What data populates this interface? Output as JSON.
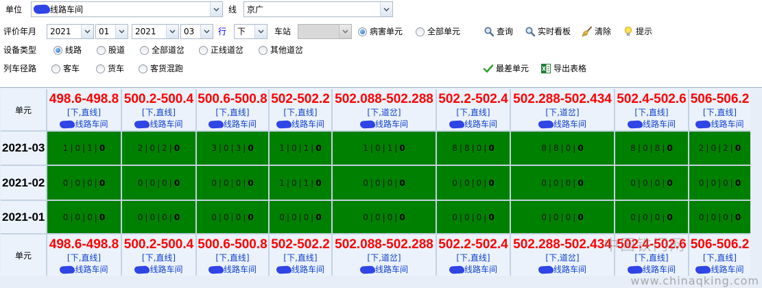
{
  "colors": {
    "defect_cell": "#008000",
    "range_text": "#ff0000",
    "unit_info_text": "#1040d0",
    "direction_label": "#0000ff",
    "redaction": "#2f45e6"
  },
  "form": {
    "unit": {
      "label": "单位",
      "value": "线路车间"
    },
    "line": {
      "label": "线",
      "value": "京广"
    },
    "period": {
      "label": "评价年月",
      "start_year": "2021",
      "start_month": "01",
      "end_year": "2021",
      "end_month": "03"
    },
    "direction": {
      "label": "行",
      "value": "下"
    },
    "station": {
      "label": "车站",
      "value": ""
    },
    "unit_scope": [
      {
        "label": "病害单元",
        "checked": true
      },
      {
        "label": "全部单元",
        "checked": false
      }
    ],
    "actions": [
      {
        "label": "查询",
        "icon": "search-icon"
      },
      {
        "label": "实时看板",
        "icon": "search-icon"
      },
      {
        "label": "清除",
        "icon": "broom-icon"
      },
      {
        "label": "提示",
        "icon": "bulb-icon"
      }
    ],
    "device_type": {
      "label": "设备类型",
      "options": [
        {
          "label": "线路",
          "checked": true
        },
        {
          "label": "股道",
          "checked": false
        },
        {
          "label": "全部道岔",
          "checked": false
        },
        {
          "label": "正线道岔",
          "checked": false
        },
        {
          "label": "其他道岔",
          "checked": false
        }
      ]
    },
    "train_route": {
      "label": "列车径路",
      "options": [
        {
          "label": "客车",
          "checked": false
        },
        {
          "label": "货车",
          "checked": false
        },
        {
          "label": "客货混跑",
          "checked": false
        }
      ]
    },
    "table_actions": [
      {
        "label": "最差单元",
        "icon": "check-icon"
      },
      {
        "label": "导出表格",
        "icon": "excel-icon"
      }
    ]
  },
  "table": {
    "corner_label": "单元",
    "cell_separator": "|",
    "columns": [
      {
        "range": "498.6-498.8",
        "type": "[下,直线]",
        "workshop": "线路车间"
      },
      {
        "range": "500.2-500.4",
        "type": "[下,直线]",
        "workshop": "线路车间"
      },
      {
        "range": "500.6-500.8",
        "type": "[下,直线]",
        "workshop": "线路车间"
      },
      {
        "range": "502-502.2",
        "type": "[下,直线]",
        "workshop": "线路车间"
      },
      {
        "range": "502.088-502.288",
        "type": "[下,道岔]",
        "workshop": "线路车间"
      },
      {
        "range": "502.2-502.4",
        "type": "[下,直线]",
        "workshop": "线路车间"
      },
      {
        "range": "502.288-502.434",
        "type": "[下,道岔]",
        "workshop": "线路车间"
      },
      {
        "range": "502.4-502.6",
        "type": "[下,直线]",
        "workshop": "线路车间"
      },
      {
        "range": "506-506.2",
        "type": "[下,直线]",
        "workshop": "线路车间"
      }
    ],
    "rows": [
      {
        "month": "2021-03",
        "cells": [
          [
            "1",
            "0",
            "1",
            "0"
          ],
          [
            "2",
            "0",
            "2",
            "0"
          ],
          [
            "3",
            "0",
            "3",
            "0"
          ],
          [
            "1",
            "0",
            "1",
            "0"
          ],
          [
            "1",
            "0",
            "1",
            "0"
          ],
          [
            "8",
            "8",
            "0",
            "0"
          ],
          [
            "8",
            "8",
            "0",
            "0"
          ],
          [
            "8",
            "0",
            "8",
            "0"
          ],
          [
            "2",
            "0",
            "2",
            "0"
          ]
        ]
      },
      {
        "month": "2021-02",
        "cells": [
          [
            "0",
            "0",
            "0",
            "0"
          ],
          [
            "0",
            "0",
            "0",
            "0"
          ],
          [
            "0",
            "0",
            "0",
            "0"
          ],
          [
            "1",
            "0",
            "1",
            "0"
          ],
          [
            "0",
            "0",
            "0",
            "0"
          ],
          [
            "0",
            "0",
            "0",
            "0"
          ],
          [
            "0",
            "0",
            "0",
            "0"
          ],
          [
            "0",
            "0",
            "0",
            "0"
          ],
          [
            "0",
            "0",
            "0",
            "0"
          ]
        ]
      },
      {
        "month": "2021-01",
        "cells": [
          [
            "0",
            "0",
            "0",
            "0"
          ],
          [
            "0",
            "0",
            "0",
            "0"
          ],
          [
            "0",
            "0",
            "0",
            "0"
          ],
          [
            "0",
            "0",
            "0",
            "0"
          ],
          [
            "0",
            "0",
            "0",
            "0"
          ],
          [
            "0",
            "0",
            "0",
            "0"
          ],
          [
            "0",
            "0",
            "0",
            "0"
          ],
          [
            "0",
            "0",
            "0",
            "0"
          ],
          [
            "0",
            "0",
            "0",
            "0"
          ]
        ]
      }
    ]
  },
  "watermark": {
    "site_name": "中国铁门网",
    "url": "www.chinaqking.com"
  }
}
